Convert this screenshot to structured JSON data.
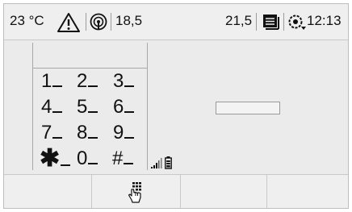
{
  "status_bar": {
    "temperature": "23 °C",
    "warning_icon": "warning-triangle-icon",
    "wireless_icon": "wireless-signal-icon",
    "trip_left": "18,5",
    "trip_right": "21,5",
    "menu_icon": "list-menu-icon",
    "settings_icon": "settings-gear-icon",
    "clock": "12:13"
  },
  "keypad": {
    "keys": [
      "1",
      "2",
      "3",
      "4",
      "5",
      "6",
      "7",
      "8",
      "9",
      "✱",
      "0",
      "#"
    ]
  },
  "indicators": {
    "signal_icon": "signal-strength-icon",
    "battery_icon": "battery-icon"
  },
  "bottom_bar": {
    "softkeys": [
      {
        "icon": ""
      },
      {
        "icon": "hand-keypad-icon"
      },
      {
        "icon": ""
      },
      {
        "icon": ""
      }
    ]
  },
  "colors": {
    "background": "#ebebeb",
    "bar": "#efefef",
    "text": "#111111",
    "separator": "#9c9c9c"
  }
}
